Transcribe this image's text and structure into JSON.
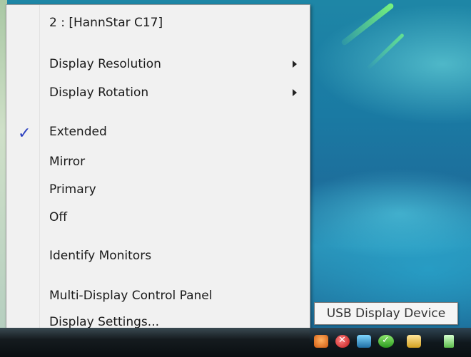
{
  "menu": {
    "header": "2 : [HannStar C17]",
    "items": [
      {
        "label": "Display Resolution",
        "submenu": true
      },
      {
        "label": "Display Rotation",
        "submenu": true
      },
      {
        "label": "Extended",
        "checked": true
      },
      {
        "label": "Mirror"
      },
      {
        "label": "Primary"
      },
      {
        "label": "Off"
      },
      {
        "label": "Identify Monitors"
      },
      {
        "label": "Multi-Display Control Panel"
      },
      {
        "label": "Display Settings..."
      }
    ],
    "checkmark": "✓"
  },
  "tooltip": {
    "text": "USB Display Device"
  },
  "tray_icons": [
    "network-warning-icon",
    "security-alert-icon",
    "network-icon",
    "usb-display-icon",
    "volume-icon",
    "power-icon"
  ],
  "colors": {
    "check": "#2a3fbf",
    "menu_bg": "#f1f1f1"
  }
}
